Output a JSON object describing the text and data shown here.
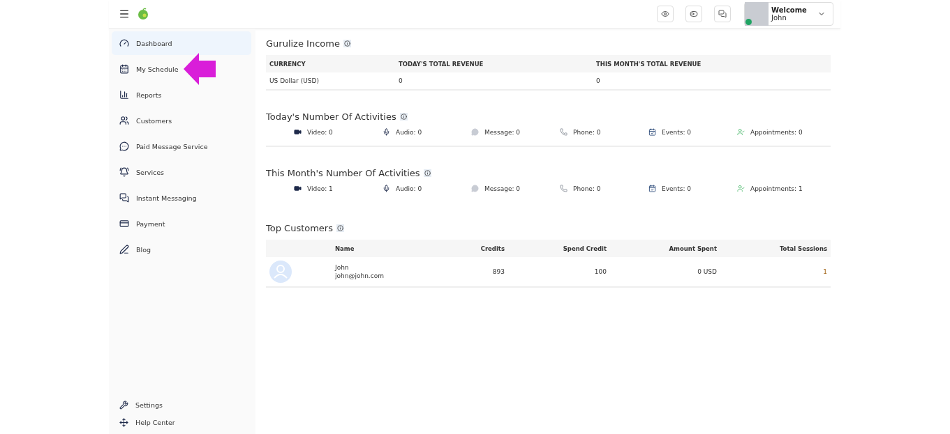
{
  "header": {
    "user": {
      "greeting": "Welcome",
      "name": "John",
      "online": true
    }
  },
  "sidebar": {
    "items": [
      {
        "label": "Dashboard",
        "selected": true
      },
      {
        "label": "My Schedule",
        "selected": false
      },
      {
        "label": "Reports",
        "selected": false
      },
      {
        "label": "Customers",
        "selected": false
      },
      {
        "label": "Paid Message Service",
        "selected": false
      },
      {
        "label": "Services",
        "selected": false
      },
      {
        "label": "Instant Messaging",
        "selected": false
      },
      {
        "label": "Payment",
        "selected": false
      },
      {
        "label": "Blog",
        "selected": false
      }
    ],
    "footer": [
      {
        "label": "Settings"
      },
      {
        "label": "Help Center"
      }
    ]
  },
  "income": {
    "title": "Gurulize Income",
    "columns": [
      "CURRENCY",
      "TODAY'S TOTAL REVENUE",
      "THIS MONTH'S TOTAL REVENUE"
    ],
    "rows": [
      [
        "US Dollar (USD)",
        "0",
        "0"
      ]
    ]
  },
  "activities": [
    {
      "title": "Today's Number Of Activities",
      "items": [
        {
          "kind": "video",
          "label": "Video: 0"
        },
        {
          "kind": "audio",
          "label": "Audio: 0"
        },
        {
          "kind": "message",
          "label": "Message: 0"
        },
        {
          "kind": "phone",
          "label": "Phone: 0"
        },
        {
          "kind": "events",
          "label": "Events: 0"
        },
        {
          "kind": "appointments",
          "label": "Appointments: 0"
        }
      ]
    },
    {
      "title": "This Month's Number Of Activities",
      "items": [
        {
          "kind": "video",
          "label": "Video: 1"
        },
        {
          "kind": "audio",
          "label": "Audio: 0"
        },
        {
          "kind": "message",
          "label": "Message: 0"
        },
        {
          "kind": "phone",
          "label": "Phone: 0"
        },
        {
          "kind": "events",
          "label": "Events: 0"
        },
        {
          "kind": "appointments",
          "label": "Appointments: 1"
        }
      ]
    }
  ],
  "top_customers": {
    "title": "Top Customers",
    "columns": [
      "Name",
      "Credits",
      "Spend Credit",
      "Amount Spent",
      "Total Sessions"
    ],
    "rows": [
      {
        "name": "John",
        "email": "john@john.com",
        "credits": "893",
        "spend_credit": "100",
        "amount_spent": "0 USD",
        "total_sessions": "1"
      }
    ]
  },
  "annotation": {
    "kind": "arrow"
  }
}
